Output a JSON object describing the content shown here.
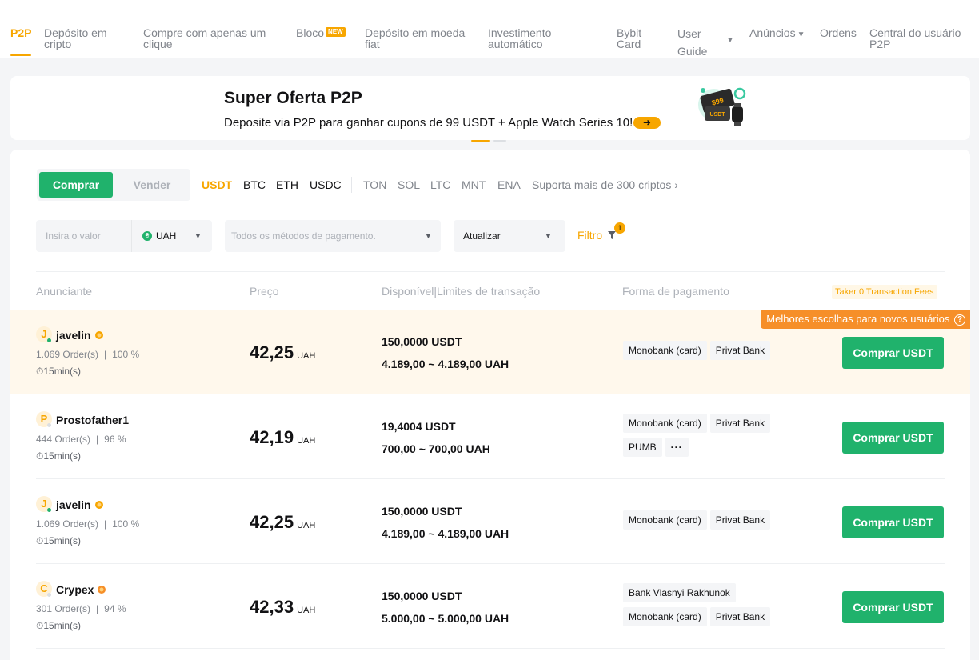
{
  "nav": {
    "items": [
      {
        "label": "P2P"
      },
      {
        "label": "Depósito em cripto"
      },
      {
        "label": "Compre com apenas um clique"
      },
      {
        "label": "Bloco",
        "badge": "NEW"
      },
      {
        "label": "Depósito em moeda fiat"
      },
      {
        "label": "Investimento automático"
      },
      {
        "label": "Bybit Card"
      },
      {
        "label": "User Guide"
      },
      {
        "label": "Anúncios"
      },
      {
        "label": "Ordens"
      },
      {
        "label": "Central do usuário P2P"
      }
    ],
    "active_color": "#f7a600"
  },
  "banner": {
    "title": "Super Oferta P2P",
    "subtitle": "Deposite via P2P para ganhar cupons de 99 USDT + Apple Watch Series 10!",
    "art_text_1": "$99",
    "art_text_2": "USDT"
  },
  "trade": {
    "buy_label": "Comprar",
    "sell_label": "Vender",
    "coins": [
      "USDT",
      "BTC",
      "ETH",
      "USDC"
    ],
    "more_coins": [
      "TON",
      "SOL",
      "LTC",
      "MNT",
      "ENA"
    ],
    "more_link": "Suporta mais de 300 criptos",
    "amount_placeholder": "Insira o valor",
    "fiat": "UAH",
    "payment_placeholder": "Todos os métodos de pagamento.",
    "refresh": "Atualizar",
    "filter": "Filtro",
    "filter_count": "1"
  },
  "table": {
    "headers": {
      "advertiser": "Anunciante",
      "price": "Preço",
      "available": "Disponível|Limites de transação",
      "payment": "Forma de pagamento"
    },
    "fee_tag": "Taker 0 Transaction Fees",
    "best_tag": "Melhores escolhas para novos usuários",
    "rows": [
      {
        "initial": "J",
        "name": "javelin",
        "online": true,
        "merchant": true,
        "orders": "1.069 Order(s)",
        "completion": "100 %",
        "time": "15min(s)",
        "price": "42,25",
        "currency": "UAH",
        "available": "150,0000 USDT",
        "limit": "4.189,00 ~ 4.189,00 UAH",
        "payments": [
          "Monobank (card)",
          "Privat Bank"
        ],
        "more": false,
        "button": "Comprar USDT"
      },
      {
        "initial": "P",
        "name": "Prostofather1",
        "online": false,
        "merchant": false,
        "orders": "444 Order(s)",
        "completion": "96 %",
        "time": "15min(s)",
        "price": "42,19",
        "currency": "UAH",
        "available": "19,4004 USDT",
        "limit": "700,00 ~ 700,00 UAH",
        "payments": [
          "Monobank (card)",
          "Privat Bank",
          "PUMB"
        ],
        "more": true,
        "button": "Comprar USDT"
      },
      {
        "initial": "J",
        "name": "javelin",
        "online": true,
        "merchant": true,
        "orders": "1.069 Order(s)",
        "completion": "100 %",
        "time": "15min(s)",
        "price": "42,25",
        "currency": "UAH",
        "available": "150,0000 USDT",
        "limit": "4.189,00 ~ 4.189,00 UAH",
        "payments": [
          "Monobank (card)",
          "Privat Bank"
        ],
        "more": false,
        "button": "Comprar USDT"
      },
      {
        "initial": "C",
        "name": "Crypex",
        "online": false,
        "merchant": true,
        "orders": "301 Order(s)",
        "completion": "94 %",
        "time": "15min(s)",
        "price": "42,33",
        "currency": "UAH",
        "available": "150,0000 USDT",
        "limit": "5.000,00 ~ 5.000,00 UAH",
        "payments": [
          "Bank Vlasnyi Rakhunok",
          "Monobank (card)",
          "Privat Bank"
        ],
        "more": false,
        "button": "Comprar USDT"
      }
    ]
  },
  "colors": {
    "accent": "#f7a600",
    "buy_green": "#20b26c",
    "highlight_row": "#fff8ec",
    "best_tag": "#f68f29"
  }
}
